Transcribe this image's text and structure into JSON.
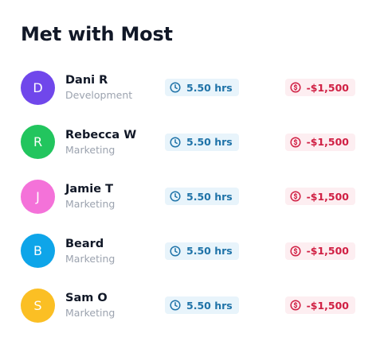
{
  "title": "Met with Most",
  "people": [
    {
      "initial": "D",
      "name": "Dani R",
      "department": "Development",
      "time": "5.50 hrs",
      "amount": "-$1,500",
      "avatar_color": "#7047eb"
    },
    {
      "initial": "R",
      "name": "Rebecca W",
      "department": "Marketing",
      "time": "5.50 hrs",
      "amount": "-$1,500",
      "avatar_color": "#22c55e"
    },
    {
      "initial": "J",
      "name": "Jamie T",
      "department": "Marketing",
      "time": "5.50 hrs",
      "amount": "-$1,500",
      "avatar_color": "#f472d9"
    },
    {
      "initial": "B",
      "name": "Beard",
      "department": "Marketing",
      "time": "5.50 hrs",
      "amount": "-$1,500",
      "avatar_color": "#0ea5e9"
    },
    {
      "initial": "S",
      "name": "Sam O",
      "department": "Marketing",
      "time": "5.50 hrs",
      "amount": "-$1,500",
      "avatar_color": "#fbbf24"
    }
  ],
  "colors": {
    "time_badge_bg": "#e8f4fb",
    "time_badge_fg": "#1f73a8",
    "amount_badge_bg": "#fdeef1",
    "amount_badge_fg": "#d01f43"
  },
  "icons": {
    "time": "clock-icon",
    "amount": "dollar-circle-icon"
  }
}
